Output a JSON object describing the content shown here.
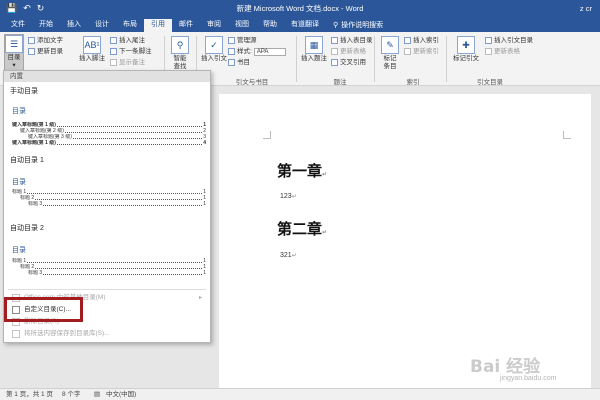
{
  "titlebar": {
    "qat_icons": [
      "save-icon",
      "undo-icon",
      "redo-icon"
    ],
    "title": "新建 Microsoft Word 文档.docx - Word",
    "user": "z cr"
  },
  "tabs": [
    "文件",
    "开始",
    "插入",
    "设计",
    "布局",
    "引用",
    "邮件",
    "审阅",
    "视图",
    "帮助",
    "有道翻译"
  ],
  "active_tab": "引用",
  "tell_me": "操作说明搜索",
  "ribbon": {
    "toc_button": "目录",
    "add_text": "添加文字",
    "update_toc": "更新目录",
    "insert_footnote": "插入脚注",
    "insert_endnote": "插入尾注",
    "next_footnote": "下一条脚注",
    "show_notes": "显示备注",
    "smart_lookup_1": "智能",
    "smart_lookup_2": "查找",
    "insert_citation": "插入引文",
    "manage_sources": "管理源",
    "style_label": "样式:",
    "style_value": "APA",
    "bibliography": "书目",
    "citations_group": "引文与书目",
    "insert_caption": "插入题注",
    "insert_table_of_figures": "插入表目录",
    "update_table": "更新表格",
    "cross_reference": "交叉引用",
    "captions_group": "题注",
    "mark_entry_1": "标记",
    "mark_entry_2": "条目",
    "insert_index": "插入索引",
    "update_index": "更新索引",
    "index_group": "索引",
    "mark_citation": "标记引文",
    "insert_toa": "插入引文目录",
    "update_toa": "更新表格",
    "toa_group": "引文目录"
  },
  "panel": {
    "header": "内置",
    "manual_toc": "手动目录",
    "auto_toc_1": "自动目录 1",
    "auto_toc_2": "自动目录 2",
    "toc_title": "目录",
    "manual_lines": [
      {
        "text": "键入章标题(第 1 级)",
        "page": "1",
        "level": 1
      },
      {
        "text": "键入章标题(第 2 级)",
        "page": "2",
        "level": 2
      },
      {
        "text": "键入章标题(第 3 级)",
        "page": "3",
        "level": 3
      },
      {
        "text": "键入章标题(第 1 级)",
        "page": "4",
        "level": 1
      }
    ],
    "auto_lines": [
      {
        "text": "标题 1",
        "page": "1",
        "level": 1
      },
      {
        "text": "标题 2",
        "page": "1",
        "level": 2
      },
      {
        "text": "标题 3",
        "page": "1",
        "level": 3
      }
    ],
    "menu": {
      "more_toc": "Office.com 中的其他目录(M)",
      "custom_toc": "自定义目录(C)...",
      "remove_toc": "删除目录(R)",
      "save_selection": "将所选内容保存到目录库(S)..."
    }
  },
  "document": {
    "heading1": "第一章",
    "para1": "123",
    "heading2": "第二章",
    "para2": "321"
  },
  "statusbar": {
    "page": "第 1 页，共 1 页",
    "words": "8 个字",
    "lang": "中文(中国)"
  },
  "watermark": {
    "main": "Bai 经验",
    "sub": "jingyan.baidu.com"
  },
  "colors": {
    "word_blue": "#2b579a",
    "highlight_red": "#a31c20"
  }
}
